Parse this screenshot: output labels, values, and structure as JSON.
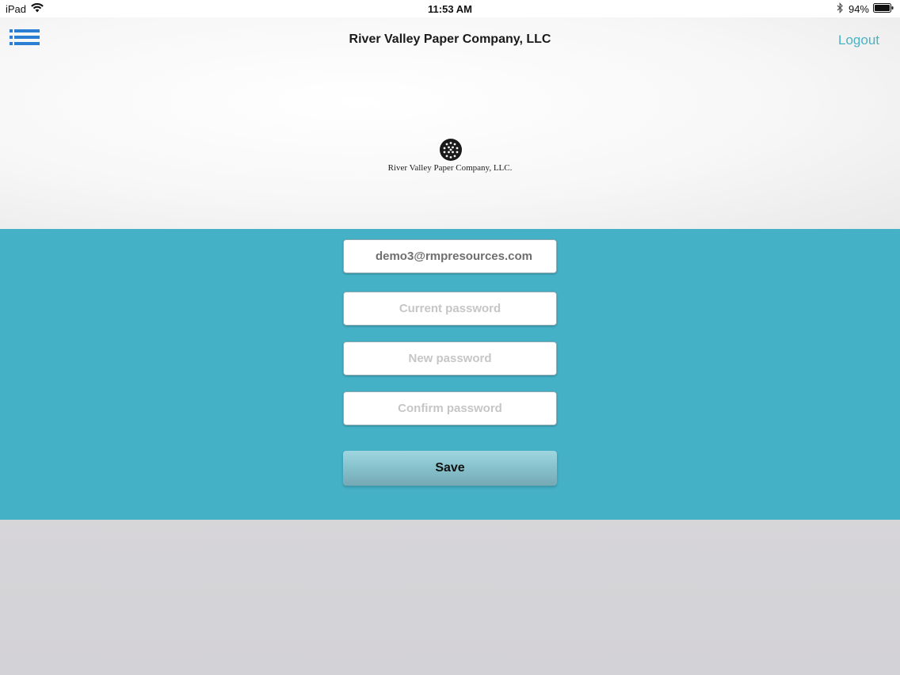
{
  "status_bar": {
    "device": "iPad",
    "time": "11:53 AM",
    "battery": "94%"
  },
  "header": {
    "title": "River Valley Paper Company, LLC",
    "logout_label": "Logout",
    "menu_icon": "hamburger-menu-icon"
  },
  "logo": {
    "text": "River Valley Paper Company, LLC."
  },
  "form": {
    "email_value": "demo3@rmpresources.com",
    "current_password_placeholder": "Current password",
    "new_password_placeholder": "New password",
    "confirm_password_placeholder": "Confirm password",
    "save_label": "Save"
  },
  "colors": {
    "accent": "#44b1c7",
    "menu_icon": "#2a7fd4",
    "logout": "#4ab3c2"
  }
}
